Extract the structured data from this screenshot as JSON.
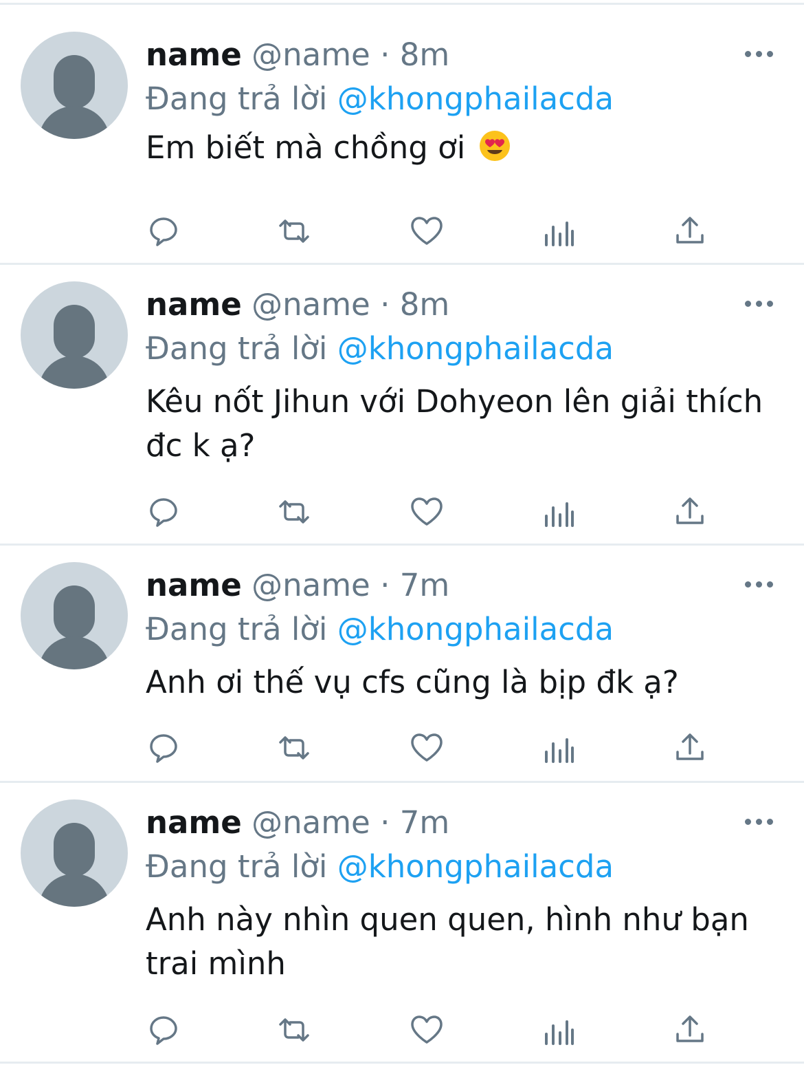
{
  "tweets": [
    {
      "name": "name",
      "handle": "@name",
      "separator": "·",
      "time": "8m",
      "reply_prefix": "Đang trả lời",
      "reply_to": "@khongphailacda",
      "text": "Em biết mà chồng ơi",
      "emoji": "heart-eyes-emoji"
    },
    {
      "name": "name",
      "handle": "@name",
      "separator": "·",
      "time": "8m",
      "reply_prefix": "Đang trả lời",
      "reply_to": "@khongphailacda",
      "text": "Kêu nốt Jihun với Dohyeon lên giải thích đc k ạ?"
    },
    {
      "name": "name",
      "handle": "@name",
      "separator": "·",
      "time": "7m",
      "reply_prefix": "Đang trả lời",
      "reply_to": "@khongphailacda",
      "text": "Anh ơi thế vụ cfs cũng là bịp đk ạ?"
    },
    {
      "name": "name",
      "handle": "@name",
      "separator": "·",
      "time": "7m",
      "reply_prefix": "Đang trả lời",
      "reply_to": "@khongphailacda",
      "text": "Anh này nhìn quen quen, hình như bạn trai mình"
    }
  ],
  "icons": [
    "reply-icon",
    "retweet-icon",
    "like-icon",
    "analytics-icon",
    "share-icon",
    "more-icon"
  ],
  "colors": {
    "text_primary": "#14171a",
    "text_secondary": "#657786",
    "mention": "#1da1f2",
    "avatar_bg": "#ccd6dd",
    "avatar_fg": "#66757f",
    "divider": "#e6ecf0"
  }
}
